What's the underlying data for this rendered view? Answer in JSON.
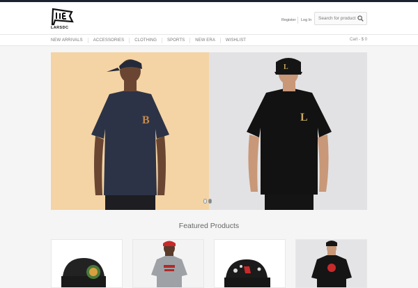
{
  "brand": {
    "name": "LARSDC"
  },
  "header": {
    "register_label": "Register",
    "login_label": "Log In",
    "search_placeholder": "Search for product"
  },
  "nav": {
    "items": [
      {
        "label": "New Arrivals"
      },
      {
        "label": "Accessories"
      },
      {
        "label": "Clothing"
      },
      {
        "label": "Sports"
      },
      {
        "label": "New Era"
      },
      {
        "label": "Wishlist"
      }
    ],
    "cart_label": "Cart - $ 0"
  },
  "hero": {
    "slides": [
      {
        "background": "#f4d4a4",
        "shirt_logo": "B"
      },
      {
        "background": "#e2e2e4",
        "shirt_logo": "L"
      }
    ],
    "dots": 2,
    "active_dot": 2
  },
  "featured": {
    "title": "Featured Products"
  },
  "colors": {
    "topbar": "#1a2230",
    "page_bg": "#f5f5f5"
  }
}
